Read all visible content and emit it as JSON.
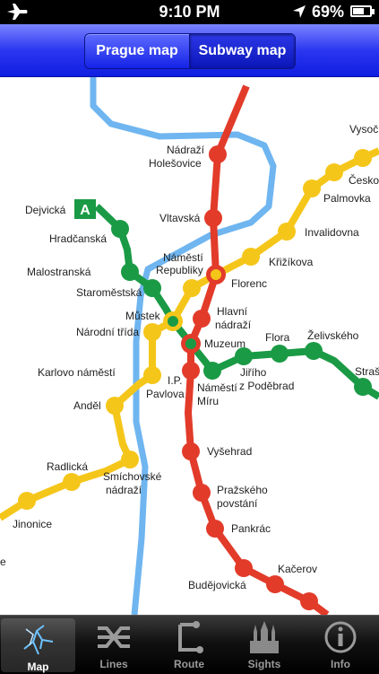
{
  "status": {
    "time": "9:10 PM",
    "battery": "69%",
    "battery_level": 0.69
  },
  "nav": {
    "segments": [
      "Prague map",
      "Subway map"
    ],
    "selected": "Subway map"
  },
  "map": {
    "line_a_badge": "A",
    "colors": {
      "green": "#1a9a45",
      "yellow": "#f5c61a",
      "red": "#e23b2a",
      "river": "#6fb5f0"
    },
    "labels": {
      "dejvicka": "Dejvická",
      "hradcanska": "Hradčanská",
      "malostranska": "Malostranská",
      "staromestska": "Staroměstská",
      "mustek": "Můstek",
      "narodni_trida": "Národní třída",
      "karlovo": "Karlovo náměstí",
      "andel": "Anděl",
      "radlicka": "Radlická",
      "smichovske1": "Smíchovské",
      "smichovske2": "nádraží",
      "jinonice": "Jinonice",
      "nadrazi_hol1": "Nádraží",
      "nadrazi_hol2": "Holešovice",
      "vltavska": "Vltavská",
      "namesti_rep1": "Náměstí",
      "namesti_rep2": "Republiky",
      "florenc": "Florenc",
      "hlavni1": "Hlavní",
      "hlavni2": "nádraží",
      "muzeum": "Muzeum",
      "ip1": "I.P.",
      "ip2": "Pavlova",
      "nm1": "Náměstí",
      "nm2": "Míru",
      "vysehrad": "Vyšehrad",
      "prazske1": "Pražského",
      "prazske2": "povstání",
      "pankrac": "Pankrác",
      "kacerov": "Kačerov",
      "budejovicka": "Budějovická",
      "krizikova": "Křižíkova",
      "invalidovna": "Invalidovna",
      "palmovka": "Palmovka",
      "cesko": "Česko",
      "vysoc": "Vysoč",
      "jiriho1": "Jiřího",
      "jiriho2": "z Poděbrad",
      "flora": "Flora",
      "zelivskeho": "Želivského",
      "stras": "Straš",
      "edge_e": "e"
    }
  },
  "tabs": [
    {
      "label": "Map"
    },
    {
      "label": "Lines"
    },
    {
      "label": "Route"
    },
    {
      "label": "Sights"
    },
    {
      "label": "Info"
    }
  ]
}
